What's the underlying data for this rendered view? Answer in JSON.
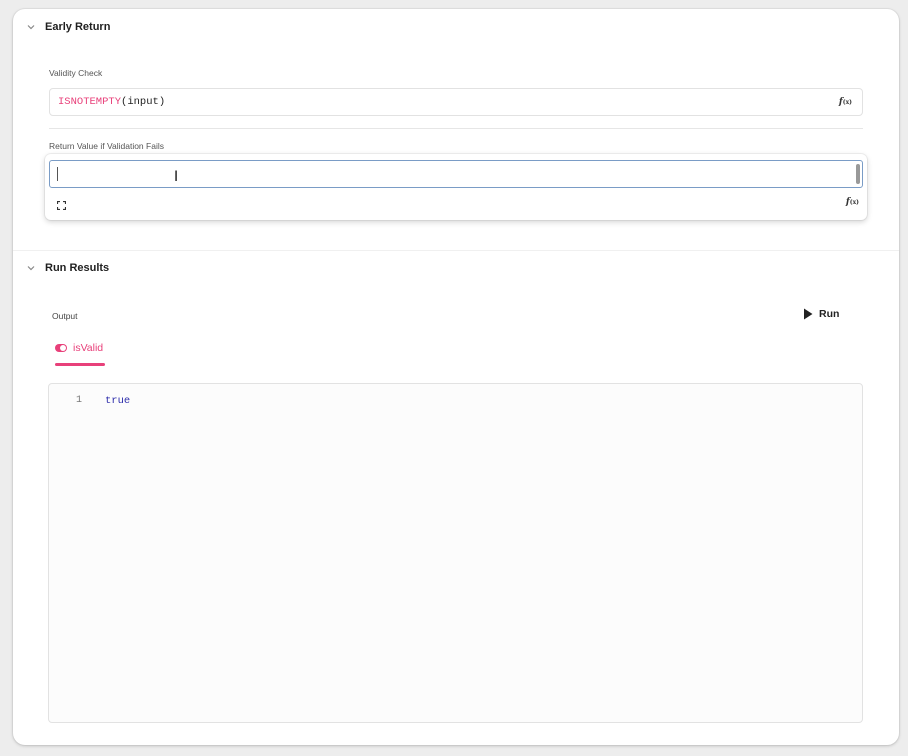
{
  "early_return": {
    "title": "Early Return",
    "validity_label": "Validity Check",
    "validity_func": "ISNOTEMPTY",
    "validity_args": "(input)",
    "fx_label": "f",
    "fx_sub": "(x)",
    "return_label": "Return Value if Validation Fails",
    "return_value": ""
  },
  "run_results": {
    "title": "Run Results",
    "output_label": "Output",
    "run_label": "Run",
    "tab_label": "isValid",
    "line_number": "1",
    "output_value": "true"
  },
  "colors": {
    "accent": "#e8407a",
    "code_keyword": "#2d2dab",
    "input_focus_border": "#7a9cc6"
  }
}
